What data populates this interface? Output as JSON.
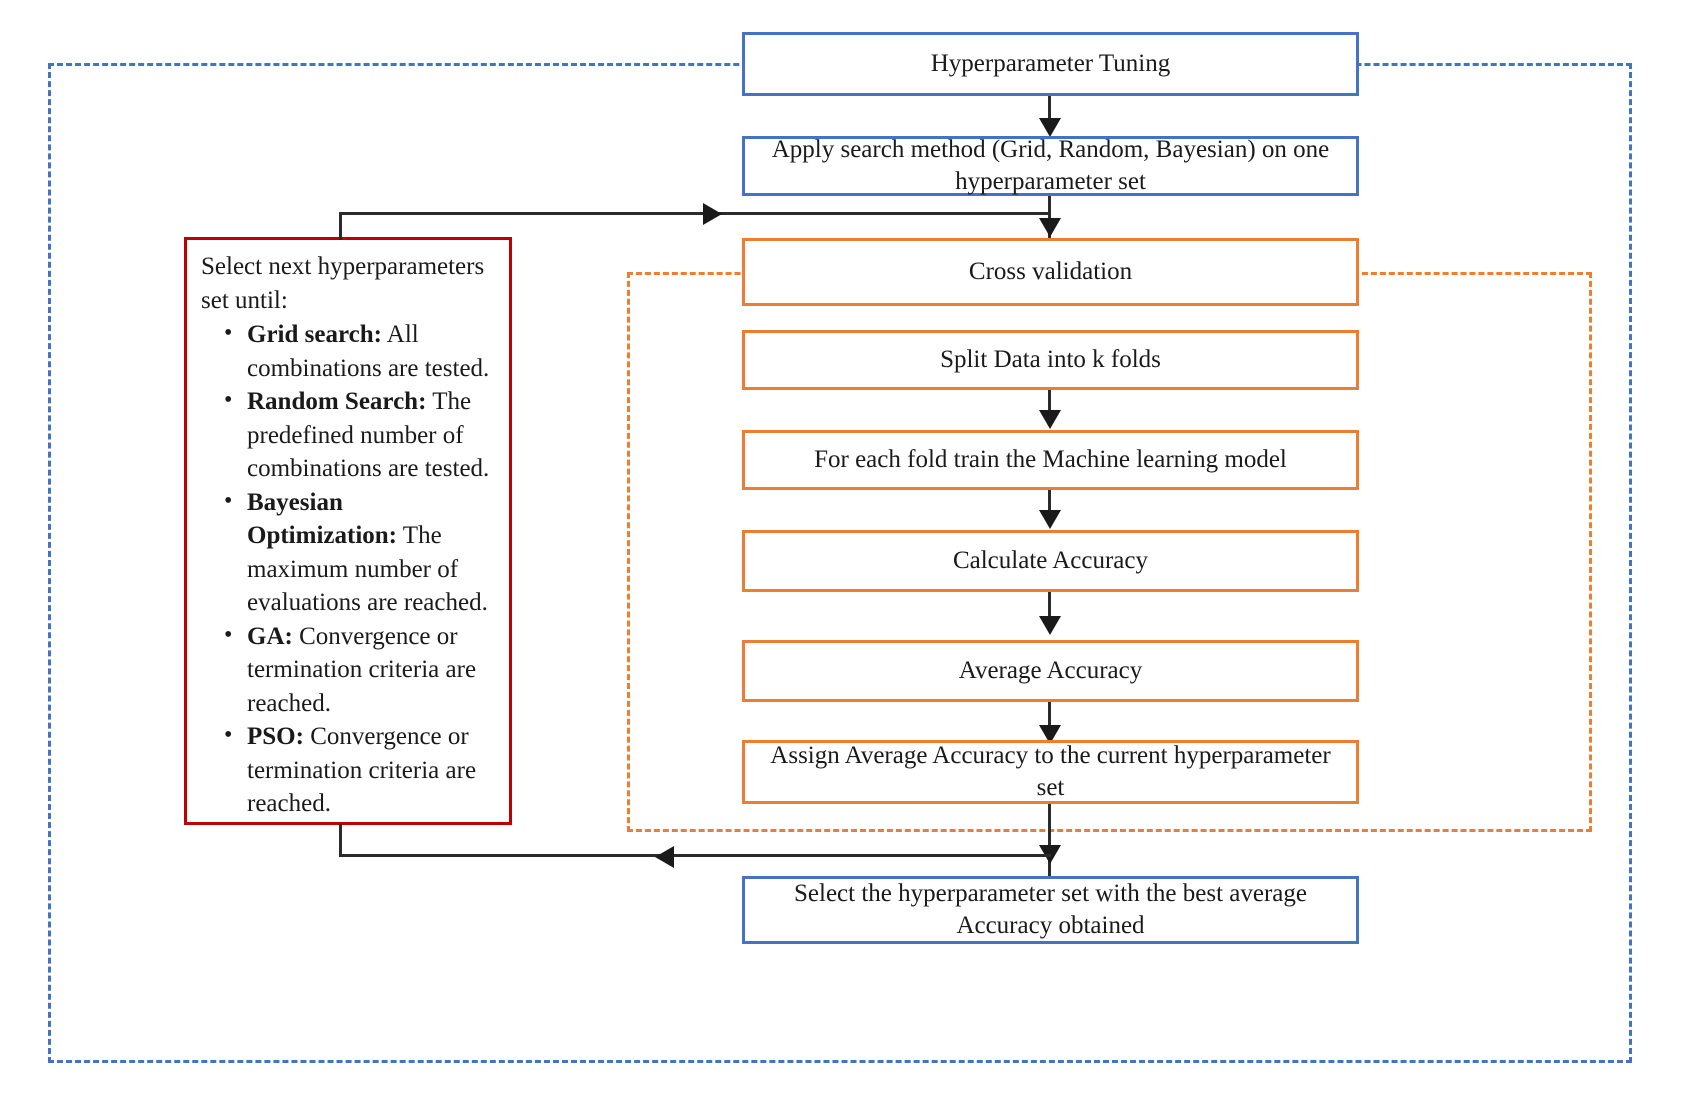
{
  "diagram": {
    "title": "Hyperparameter Tuning Workflow Flowchart",
    "colors": {
      "blue": "#4472c4",
      "orange": "#ed7d31",
      "red": "#c00000",
      "connector": "#1a1a1a"
    }
  },
  "outer_group": {
    "label": "hyperparameter-tuning-scope",
    "style": "blue-dashed"
  },
  "inner_group": {
    "label": "cross-validation-scope",
    "style": "orange-dashed"
  },
  "nodes": {
    "hyperparameter_tuning": "Hyperparameter Tuning",
    "apply_search_method": "Apply search method (Grid, Random, Bayesian) on one hyperparameter set",
    "cross_validation": "Cross validation",
    "split_data": "Split Data into k folds",
    "train_model": "For each fold train the Machine learning model",
    "calculate_accuracy": "Calculate Accuracy",
    "average_accuracy": "Average Accuracy",
    "assign_accuracy": "Assign Average Accuracy to the current hyperparameter set",
    "select_best": "Select the hyperparameter set with the best average Accuracy obtained"
  },
  "note_box": {
    "lead": "Select next hyperparameters set until:",
    "items": [
      {
        "term": "Grid search:",
        "desc": " All combinations are tested."
      },
      {
        "term": "Random Search:",
        "desc": " The predefined number of combinations are tested."
      },
      {
        "term": "Bayesian Optimization:",
        "desc": " The maximum number of evaluations are reached."
      },
      {
        "term": "GA:",
        "desc": " Convergence or termination criteria are reached."
      },
      {
        "term": "PSO:",
        "desc": " Convergence or termination criteria are reached."
      }
    ]
  },
  "connectors": {
    "tuning_to_search": "arrow-down",
    "search_to_cv": "arrow-down",
    "split_to_train": "arrow-down",
    "train_to_calc": "arrow-down",
    "calc_to_avg": "arrow-down",
    "avg_to_assign": "arrow-down",
    "assign_to_select": "arrow-down",
    "feedback_to_note": "arrow-left",
    "note_to_search": "arrow-right"
  }
}
